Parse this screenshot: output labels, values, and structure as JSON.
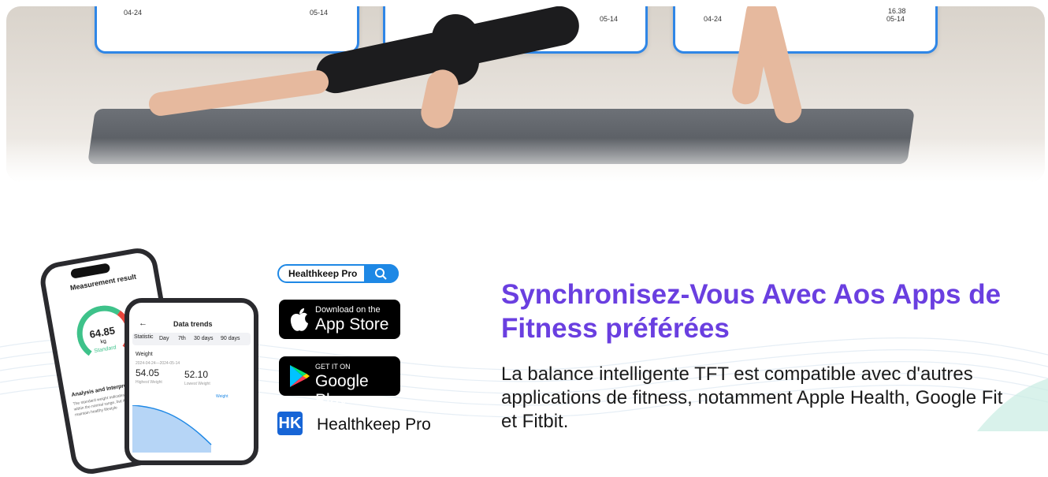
{
  "hero": {
    "cards": [
      {
        "date_start": "04-24",
        "date_end": "05-14",
        "value": ""
      },
      {
        "date_start": "",
        "date_end": "05-14",
        "value": ""
      },
      {
        "date_start": "04-24",
        "date_end": "05-14",
        "value": "16.38"
      }
    ]
  },
  "phone_back": {
    "header": "Measurement result",
    "weight_value": "64.85",
    "weight_unit": "kg",
    "status": "Standard",
    "analysis_title": "Analysis and Interpretation",
    "analysis_text": "The standard weight indicates that the value is within the normal range, but it is necessary to maintain healthy lifestyle"
  },
  "phone_front": {
    "title": "Data trends",
    "tabs": [
      "Statistic",
      "Day",
      "7th",
      "30 days",
      "90 days"
    ],
    "metric": "Weight",
    "date_range": "2024-04-24—2024-05-14",
    "high_value": "54.05",
    "high_label": "Highest Weight",
    "low_value": "52.10",
    "low_label": "Lowest Weight",
    "legend": "Weight"
  },
  "search": {
    "label": "Healthkeep Pro"
  },
  "appstore": {
    "small": "Download on the",
    "big": "App Store"
  },
  "googleplay": {
    "small": "GET IT ON",
    "big": "Google Play"
  },
  "healthkeep": {
    "logo": "HK",
    "name": "Healthkeep Pro"
  },
  "headline": "Synchronisez-Vous Avec Aos Apps de Fitness préférées",
  "description": "La balance intelligente TFT est compatible avec d'autres applications de fitness, notamment Apple Health, Google Fit et Fitbit.",
  "colors": {
    "accent_blue": "#1e88e5",
    "headline_purple": "#6a3fe0"
  },
  "icons": [
    "search-icon",
    "apple-icon",
    "google-play-icon",
    "healthkeep-logo-icon"
  ]
}
